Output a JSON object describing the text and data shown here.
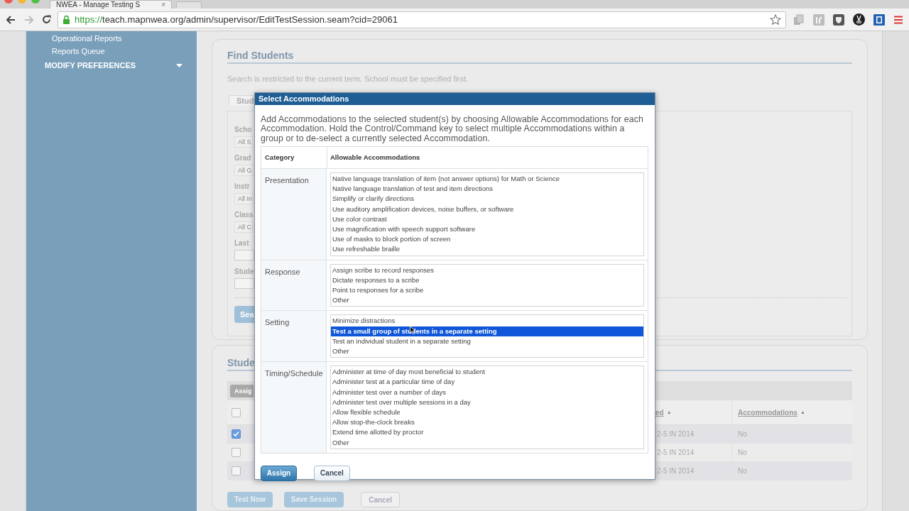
{
  "browser": {
    "tab_title": "NWEA - Manage Testing S",
    "tab_close": "×",
    "url_scheme": "https://",
    "url_rest": "teach.mapnwea.org/admin/supervisor/EditTestSession.seam?cid=29061"
  },
  "sidebar": {
    "items": [
      {
        "label": "Operational Reports",
        "kind": "link"
      },
      {
        "label": "Reports Queue",
        "kind": "link"
      },
      {
        "label": "MODIFY PREFERENCES",
        "kind": "section"
      }
    ]
  },
  "find_students": {
    "title": "Find Students",
    "note": "Search is restricted to the current term. School must be specified first.",
    "tab": "Stud",
    "fields": [
      {
        "label": "Scho",
        "kind": "select",
        "value": "All S"
      },
      {
        "label": "Grad",
        "kind": "select",
        "value": "All G"
      },
      {
        "label": "Instr",
        "kind": "select",
        "value": "All In"
      },
      {
        "label": "Class",
        "kind": "select",
        "value": "All C"
      },
      {
        "label": "Last",
        "kind": "text"
      },
      {
        "label": "Stude",
        "kind": "text"
      }
    ],
    "search_button": "Sea"
  },
  "students": {
    "title": "Stude",
    "assign_button": "Assig",
    "header_checked": false,
    "columns": [
      {
        "label": "ed",
        "sort": "▲"
      },
      {
        "label": "Accommodations",
        "sort": "▲"
      }
    ],
    "rows": [
      {
        "checked": true,
        "cells": [
          "2-5 IN 2014",
          "No"
        ]
      },
      {
        "checked": false,
        "cells": [
          "2-5 IN 2014",
          "No"
        ]
      },
      {
        "checked": false,
        "cells": [
          "2-5 IN 2014",
          "No"
        ]
      }
    ],
    "buttons": [
      "Test Now",
      "Save Session",
      "Cancel"
    ]
  },
  "dialog": {
    "title": "Select Accommodations",
    "description": "Add Accommodations to the selected student(s) by choosing Allowable Accommodations for each Accommodation. Hold the Control/Command key to select multiple Accommodations within a group or to de-select a currently selected Accommodation.",
    "columns": [
      "Category",
      "Allowable Accommodations"
    ],
    "groups": [
      {
        "category": "Presentation",
        "options": [
          {
            "label": "Native language translation of item (not answer options) for Math or Science",
            "selected": false
          },
          {
            "label": "Native language translation of test and item directions",
            "selected": false
          },
          {
            "label": "Simplify or clarify directions",
            "selected": false
          },
          {
            "label": "Use auditory amplification devices, noise buffers, or software",
            "selected": false
          },
          {
            "label": "Use color contrast",
            "selected": false
          },
          {
            "label": "Use magnification with speech support software",
            "selected": false
          },
          {
            "label": "Use of masks to block portion of screen",
            "selected": false
          },
          {
            "label": "Use refreshable braille",
            "selected": false
          }
        ]
      },
      {
        "category": "Response",
        "options": [
          {
            "label": "Assign scribe to record responses",
            "selected": false
          },
          {
            "label": "Dictate responses to a scribe",
            "selected": false
          },
          {
            "label": "Point to responses for a scribe",
            "selected": false
          },
          {
            "label": "Other",
            "selected": false
          }
        ]
      },
      {
        "category": "Setting",
        "options": [
          {
            "label": "Minimize distractions",
            "selected": false
          },
          {
            "label": "Test a small group of students in a separate setting",
            "selected": true
          },
          {
            "label": "Test an individual student in a separate setting",
            "selected": false
          },
          {
            "label": "Other",
            "selected": false
          }
        ]
      },
      {
        "category": "Timing/Schedule",
        "options": [
          {
            "label": "Administer at time of day most beneficial to student",
            "selected": false
          },
          {
            "label": "Administer test at a particular time of day",
            "selected": false
          },
          {
            "label": "Administer test over a number of days",
            "selected": false
          },
          {
            "label": "Administer test over multiple sessions in a day",
            "selected": false
          },
          {
            "label": "Allow flexible schedule",
            "selected": false
          },
          {
            "label": "Allow stop-the-clock breaks",
            "selected": false
          },
          {
            "label": "Extend time allotted by proctor",
            "selected": false
          },
          {
            "label": "Other",
            "selected": false
          }
        ]
      }
    ],
    "buttons": [
      {
        "label": "Assign",
        "kind": "primary"
      },
      {
        "label": "Cancel",
        "kind": "secondary"
      }
    ]
  }
}
